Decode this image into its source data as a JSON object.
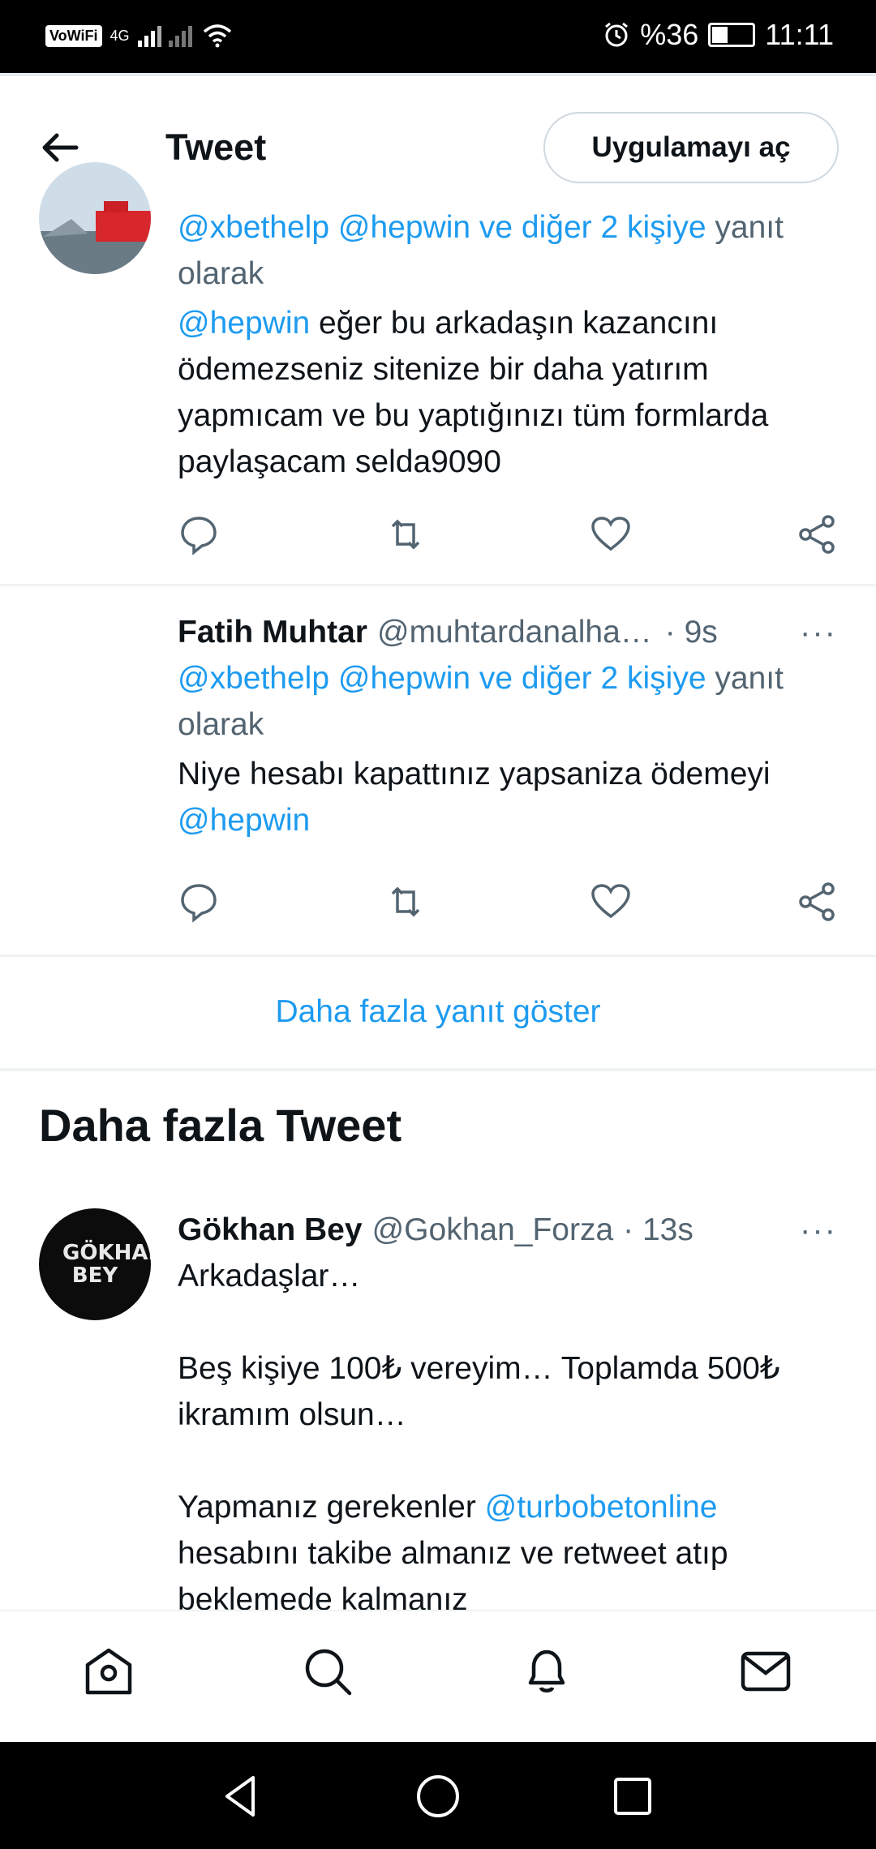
{
  "status_bar": {
    "vowifi": "VoWiFi",
    "network": "4G",
    "battery": "%36",
    "time": "11:11"
  },
  "header": {
    "title": "Tweet",
    "open_app": "Uygulamayı aç"
  },
  "tweets": [
    {
      "reply_to_users": "@xbethelp @hepwin  ve diğer 2 kişiye",
      "reply_to_suffix": "yanıt olarak",
      "mention": "@hepwin",
      "text": "eğer bu arkadaşın kazancını ödemezseniz sitenize bir daha yatırım yapmıcam ve bu yaptığınızı tüm formlarda paylaşacam selda9090"
    },
    {
      "name": "Fatih Muhtar",
      "handle": "@muhtardanalha…",
      "time": "· 9s",
      "reply_to_users": "@xbethelp @hepwin  ve diğer 2 kişiye",
      "reply_to_suffix": "yanıt olarak",
      "text": "Niye hesabı kapattınız yapsaniza ödemeyi",
      "mention": "@hepwin"
    }
  ],
  "show_more_replies": "Daha fazla yanıt göster",
  "more_tweets_title": "Daha fazla Tweet",
  "featured": {
    "name": "Gökhan Bey",
    "handle": "@Gokhan_Forza",
    "time": "· 13s",
    "avatar_text": "GÖKHAN BEY",
    "line1": "Arkadaşlar…",
    "line2": "Beş kişiye 100₺ vereyim… Toplamda 500₺ ikramım olsun…",
    "line3_prefix": "Yapmanız gerekenler",
    "line3_mention": "@turbobetonline",
    "line3_suffix": "hesabını takibe almanız ve retweet atıp beklemede kalmanız"
  },
  "more_icon": "···",
  "icons": {
    "accent": "#1d9bf0",
    "text": "#0f1419",
    "muted": "#536471"
  }
}
